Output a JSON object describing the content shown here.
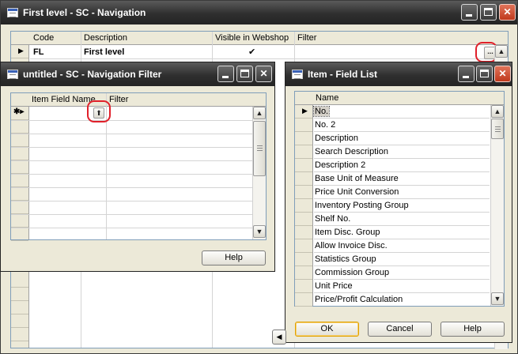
{
  "main": {
    "title": "First level - SC - Navigation",
    "columns": [
      "Code",
      "Description",
      "Visible in Webshop",
      "Filter"
    ],
    "row": {
      "code": "FL",
      "description": "First level",
      "visible": "✔",
      "filter_button": "..."
    }
  },
  "filterWin": {
    "title": "untitled - SC - Navigation Filter",
    "columns": [
      "Item Field Name",
      "Filter"
    ],
    "new_row_marker": "✱▸",
    "help": "Help"
  },
  "fieldList": {
    "title": "Item - Field List",
    "header": "Name",
    "items": [
      "No.",
      "No. 2",
      "Description",
      "Search Description",
      "Description 2",
      "Base Unit of Measure",
      "Price Unit Conversion",
      "Inventory Posting Group",
      "Shelf No.",
      "Item Disc. Group",
      "Allow Invoice Disc.",
      "Statistics Group",
      "Commission Group",
      "Unit Price",
      "Price/Profit Calculation"
    ],
    "ok": "OK",
    "cancel": "Cancel",
    "help": "Help"
  },
  "colors": {
    "title_dark": "#2f2f2f",
    "close_red": "#c0391c",
    "highlight_red": "#e0202a"
  }
}
